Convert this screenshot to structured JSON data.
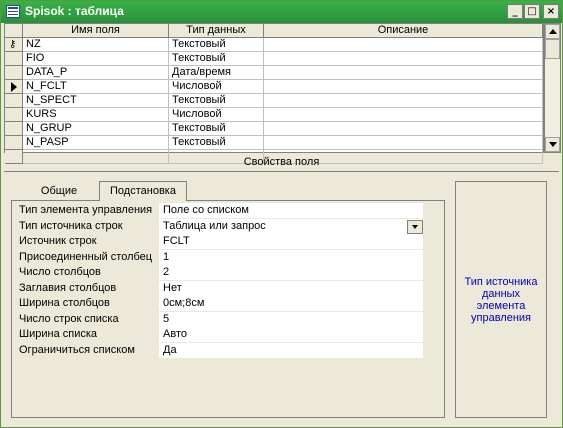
{
  "window": {
    "title": "Spisok : таблица",
    "controls": {
      "minimize": "_",
      "maximize": "□",
      "close": "×"
    }
  },
  "grid": {
    "columns": [
      "Имя поля",
      "Тип данных",
      "Описание"
    ],
    "rows": [
      {
        "name": "NZ",
        "type": "Текстовый",
        "desc": "",
        "indicator": "key-icon"
      },
      {
        "name": "FIO",
        "type": "Текстовый",
        "desc": "",
        "indicator": ""
      },
      {
        "name": "DATA_P",
        "type": "Дата/время",
        "desc": "",
        "indicator": ""
      },
      {
        "name": "N_FCLT",
        "type": "Числовой",
        "desc": "",
        "indicator": "current-row-arrow-icon"
      },
      {
        "name": "N_SPECT",
        "type": "Текстовый",
        "desc": "",
        "indicator": ""
      },
      {
        "name": "KURS",
        "type": "Числовой",
        "desc": "",
        "indicator": ""
      },
      {
        "name": "N_GRUP",
        "type": "Текстовый",
        "desc": "",
        "indicator": ""
      },
      {
        "name": "N_PASP",
        "type": "Текстовый",
        "desc": "",
        "indicator": ""
      },
      {
        "name": "",
        "type": "",
        "desc": "",
        "indicator": ""
      }
    ]
  },
  "properties": {
    "header": "Свойства поля",
    "tabs": [
      "Общие",
      "Подстановка"
    ],
    "active_tab": "Подстановка",
    "items": [
      {
        "label": "Тип элемента управления",
        "value": "Поле со списком"
      },
      {
        "label": "Тип источника строк",
        "value": "Таблица или запрос"
      },
      {
        "label": "Источник строк",
        "value": "FCLT"
      },
      {
        "label": "Присоединенный столбец",
        "value": "1"
      },
      {
        "label": "Число столбцов",
        "value": "2"
      },
      {
        "label": "Заглавия столбцов",
        "value": "Нет"
      },
      {
        "label": "Ширина столбцов",
        "value": "0см;8см"
      },
      {
        "label": "Число строк списка",
        "value": "5"
      },
      {
        "label": "Ширина списка",
        "value": "Авто"
      },
      {
        "label": "Ограничиться списком",
        "value": "Да"
      }
    ],
    "help_text": "Тип источника данных элемента управления"
  },
  "colors": {
    "titlebar": "#2a8f39",
    "help_text": "#0000c0"
  }
}
